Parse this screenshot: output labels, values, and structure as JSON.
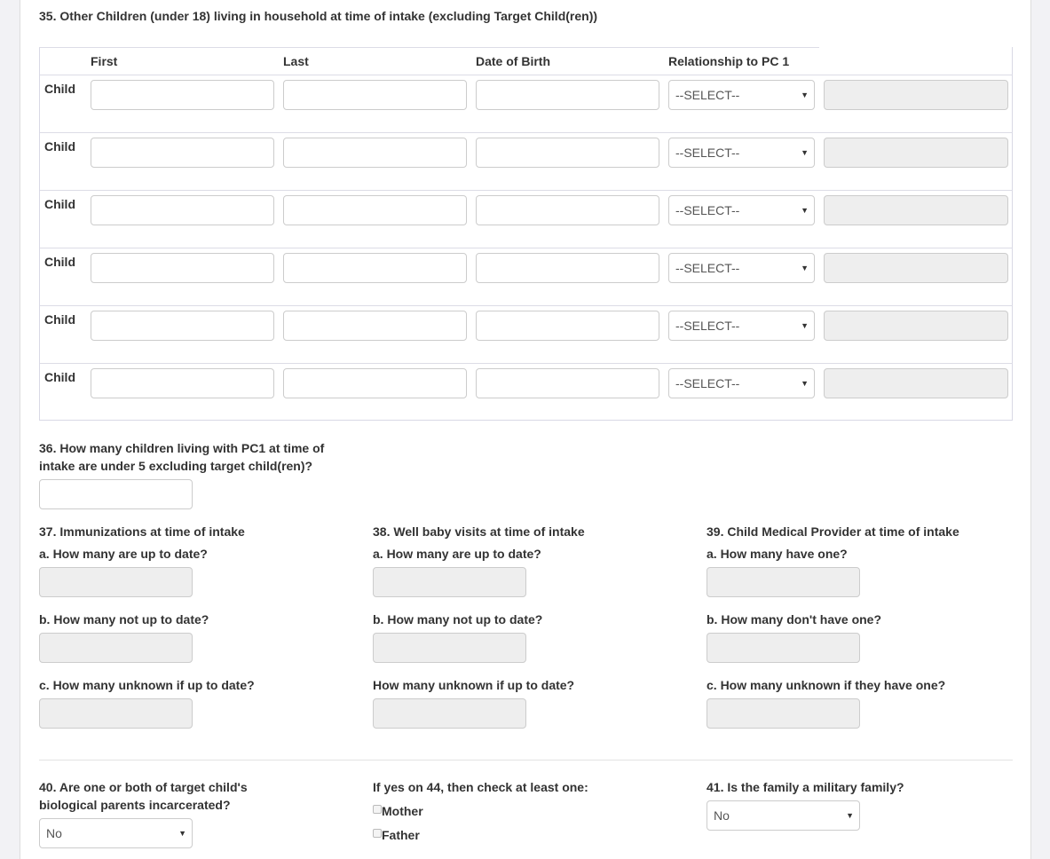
{
  "q35": {
    "title": "35. Other Children (under 18) living in household at time of intake (excluding Target Child(ren))",
    "headers": [
      "First",
      "Last",
      "Date of Birth",
      "Relationship to PC 1"
    ],
    "rows": [
      {
        "label": "Child",
        "select": "--SELECT--"
      },
      {
        "label": "Child",
        "select": "--SELECT--"
      },
      {
        "label": "Child",
        "select": "--SELECT--"
      },
      {
        "label": "Child",
        "select": "--SELECT--"
      },
      {
        "label": "Child",
        "select": "--SELECT--"
      },
      {
        "label": "Child",
        "select": "--SELECT--"
      }
    ]
  },
  "q36": {
    "line1": "36. How many children living with PC1 at time of",
    "line2": "intake are under 5 excluding target child(ren)?"
  },
  "q37": {
    "title": "37. Immunizations at time of intake",
    "a": "a. How many are up to date?",
    "b": "b. How many not up to date?",
    "c": "c. How many unknown if up to date?"
  },
  "q38": {
    "title": "38. Well baby visits at time of intake",
    "a": "a. How many are up to date?",
    "b": "b. How many not up to date?",
    "c": "How many unknown if up to date?"
  },
  "q39": {
    "title": "39. Child Medical Provider at time of intake",
    "a": "a. How many have one?",
    "b": "b. How many don't have one?",
    "c": "c. How many unknown if they have one?"
  },
  "q40": {
    "line1": "40. Are one or both of target child's",
    "line2": "biological parents incarcerated?",
    "select": "No"
  },
  "q44": {
    "title": "If yes on 44, then check at least one:",
    "opt1": "Mother",
    "opt2": "Father"
  },
  "q41": {
    "title": "41. Is the family a military family?",
    "select": "No"
  },
  "icons": {
    "dropdown": "caret-down-icon",
    "checkbox": "checkbox-icon"
  }
}
